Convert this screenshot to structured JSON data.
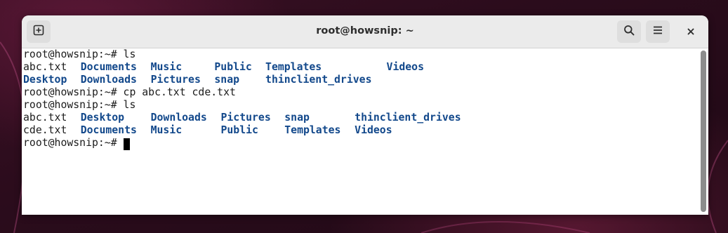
{
  "window": {
    "title": "root@howsnip: ~"
  },
  "icons": {
    "new_tab": "new-tab-icon",
    "search": "search-icon",
    "menu": "hamburger-menu-icon",
    "close": "close-icon"
  },
  "colors": {
    "directory": "#12488b",
    "text": "#1c1c1c",
    "headerbar": "#ebebeb"
  },
  "terminal": {
    "lines": [
      {
        "tokens": [
          {
            "text": "root@howsnip:~# ls",
            "kind": "plain",
            "col": 0
          }
        ]
      },
      {
        "tokens": [
          {
            "text": "abc.txt",
            "kind": "file",
            "col": 0
          },
          {
            "text": "Documents",
            "kind": "dir",
            "col": 9
          },
          {
            "text": "Music",
            "kind": "dir",
            "col": 20
          },
          {
            "text": "Public",
            "kind": "dir",
            "col": 30
          },
          {
            "text": "Templates",
            "kind": "dir",
            "col": 38
          },
          {
            "text": "Videos",
            "kind": "dir",
            "col": 57
          }
        ]
      },
      {
        "tokens": [
          {
            "text": "Desktop",
            "kind": "dir",
            "col": 0
          },
          {
            "text": "Downloads",
            "kind": "dir",
            "col": 9
          },
          {
            "text": "Pictures",
            "kind": "dir",
            "col": 20
          },
          {
            "text": "snap",
            "kind": "dir",
            "col": 30
          },
          {
            "text": "thinclient_drives",
            "kind": "dir",
            "col": 38
          }
        ]
      },
      {
        "tokens": [
          {
            "text": "root@howsnip:~# cp abc.txt cde.txt",
            "kind": "plain",
            "col": 0
          }
        ]
      },
      {
        "tokens": [
          {
            "text": "root@howsnip:~# ls",
            "kind": "plain",
            "col": 0
          }
        ]
      },
      {
        "tokens": [
          {
            "text": "abc.txt",
            "kind": "file",
            "col": 0
          },
          {
            "text": "Desktop",
            "kind": "dir",
            "col": 9
          },
          {
            "text": "Downloads",
            "kind": "dir",
            "col": 20
          },
          {
            "text": "Pictures",
            "kind": "dir",
            "col": 31
          },
          {
            "text": "snap",
            "kind": "dir",
            "col": 41
          },
          {
            "text": "thinclient_drives",
            "kind": "dir",
            "col": 52
          }
        ]
      },
      {
        "tokens": [
          {
            "text": "cde.txt",
            "kind": "file",
            "col": 0
          },
          {
            "text": "Documents",
            "kind": "dir",
            "col": 9
          },
          {
            "text": "Music",
            "kind": "dir",
            "col": 20
          },
          {
            "text": "Public",
            "kind": "dir",
            "col": 31
          },
          {
            "text": "Templates",
            "kind": "dir",
            "col": 41
          },
          {
            "text": "Videos",
            "kind": "dir",
            "col": 52
          }
        ]
      },
      {
        "tokens": [
          {
            "text": "root@howsnip:~#",
            "kind": "plain",
            "col": 0
          }
        ]
      }
    ]
  }
}
